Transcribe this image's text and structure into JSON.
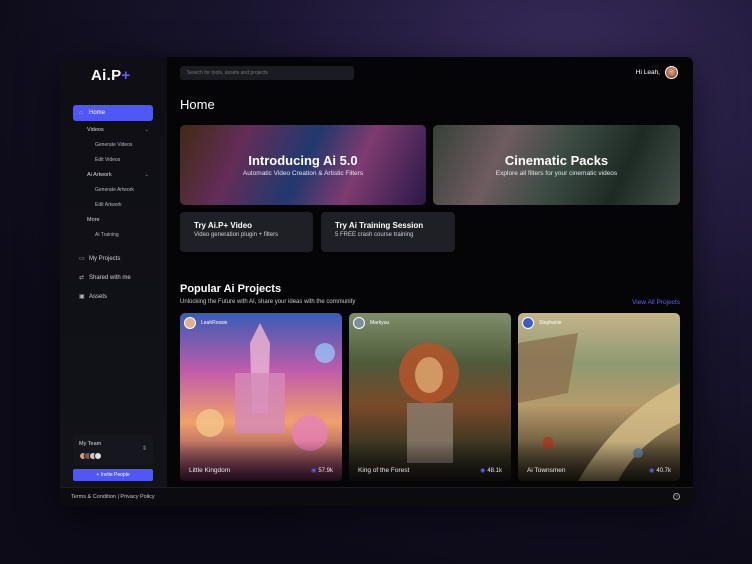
{
  "app": {
    "logo_main": "Ai.P",
    "logo_plus": "+"
  },
  "search": {
    "placeholder": "Search for tools, assets and projects"
  },
  "header": {
    "greeting": "Hi Leah,"
  },
  "sidebar": {
    "home": "Home",
    "videos": "Videos",
    "generate_videos": "Generate Videos",
    "edit_videos": "Edit Videos",
    "ai_artwork": "Ai Artwork",
    "generate_artwork": "Generate Artwork",
    "edit_artwork": "Edit Artwork",
    "more": "More",
    "ai_training": "Ai Training",
    "my_projects": "My Projects",
    "shared_with_me": "Shared with me",
    "assets": "Assets"
  },
  "team": {
    "label": "My Team",
    "invite": "+ Invite People"
  },
  "main": {
    "title": "Home",
    "hero1": {
      "title": "Introducing Ai 5.0",
      "subtitle": "Automatic Video Creation & Artistic Filters"
    },
    "hero2": {
      "title": "Cinematic Packs",
      "subtitle": "Explore all filters for your cinematic videos"
    },
    "promo1": {
      "title": "Try Ai.P+ Video",
      "subtitle": "Video generation plugin + filters"
    },
    "promo2": {
      "title": "Try Ai Training Session",
      "subtitle": "5 FREE crash course training"
    },
    "section_title": "Popular Ai Projects",
    "section_subtitle": "Unlocking the Future with AI, share your ideas with the community",
    "view_all": "View All Projects"
  },
  "projects": [
    {
      "author": "LeahRossie",
      "name": "Little Kingdom",
      "views": "57.9k"
    },
    {
      "author": "Markyuu",
      "name": "King of the Forest",
      "views": "48.1k"
    },
    {
      "author": "Stephanie",
      "name": "Ai Townsmen",
      "views": "40.7k"
    }
  ],
  "footer": {
    "links": "Terms & Condition | Privacy Policy",
    "help": "?"
  },
  "colors": {
    "accent": "#4f57f5",
    "background": "#050507",
    "card": "#1f1f26"
  }
}
